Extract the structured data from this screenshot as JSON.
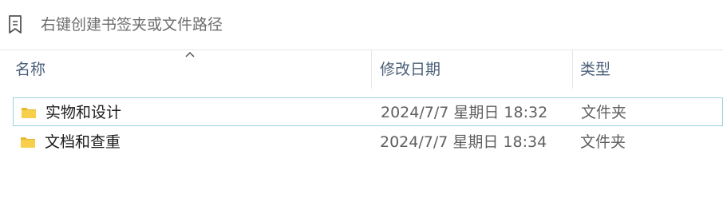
{
  "bookmark_bar": {
    "icon": "bookmark-icon",
    "placeholder": "右键创建书签夹或文件路径"
  },
  "columns": {
    "name": "名称",
    "date": "修改日期",
    "type": "类型",
    "sort_icon": "chevron-up-icon"
  },
  "rows": [
    {
      "name": "实物和设计",
      "modified": "2024/7/7 星期日 18:32",
      "type": "文件夹",
      "icon": "folder-icon",
      "selected": true
    },
    {
      "name": "文档和查重",
      "modified": "2024/7/7 星期日 18:34",
      "type": "文件夹",
      "icon": "folder-icon",
      "selected": false
    }
  ],
  "colors": {
    "selection_border": "#99d1db",
    "folder_yellow": "#f5c542",
    "header_text": "#4c607a"
  }
}
